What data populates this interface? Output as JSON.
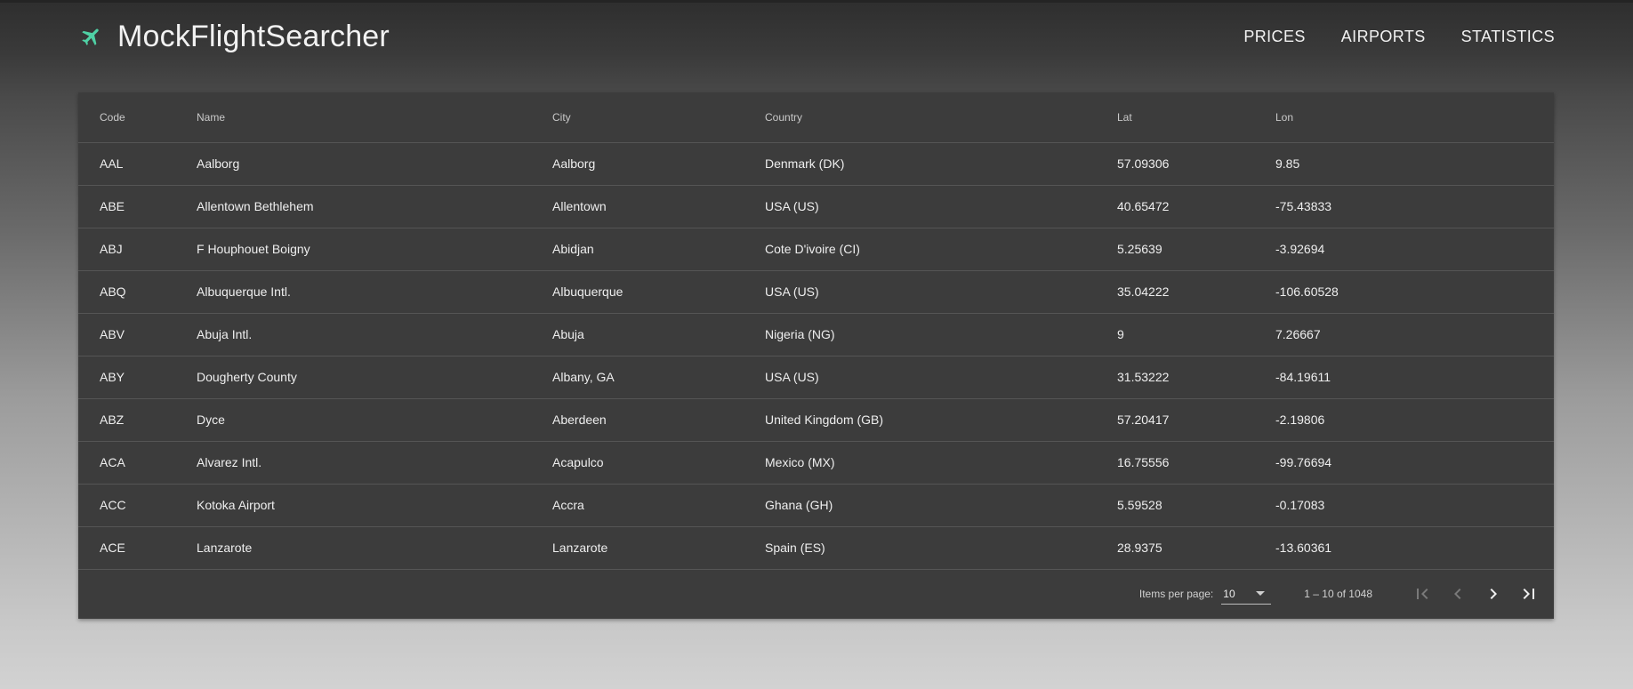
{
  "app": {
    "title": "MockFlightSearcher",
    "logo_icon": "airplane-icon",
    "accent": "#4fd1a5"
  },
  "nav": [
    "PRICES",
    "AIRPORTS",
    "STATISTICS"
  ],
  "table": {
    "columns": [
      "Code",
      "Name",
      "City",
      "Country",
      "Lat",
      "Lon"
    ],
    "rows": [
      [
        "AAL",
        "Aalborg",
        "Aalborg",
        "Denmark (DK)",
        "57.09306",
        "9.85"
      ],
      [
        "ABE",
        "Allentown Bethlehem",
        "Allentown",
        "USA (US)",
        "40.65472",
        "-75.43833"
      ],
      [
        "ABJ",
        "F Houphouet Boigny",
        "Abidjan",
        "Cote D'ivoire (CI)",
        "5.25639",
        "-3.92694"
      ],
      [
        "ABQ",
        "Albuquerque Intl.",
        "Albuquerque",
        "USA (US)",
        "35.04222",
        "-106.60528"
      ],
      [
        "ABV",
        "Abuja Intl.",
        "Abuja",
        "Nigeria (NG)",
        "9",
        "7.26667"
      ],
      [
        "ABY",
        "Dougherty County",
        "Albany, GA",
        "USA (US)",
        "31.53222",
        "-84.19611"
      ],
      [
        "ABZ",
        "Dyce",
        "Aberdeen",
        "United Kingdom (GB)",
        "57.20417",
        "-2.19806"
      ],
      [
        "ACA",
        "Alvarez Intl.",
        "Acapulco",
        "Mexico (MX)",
        "16.75556",
        "-99.76694"
      ],
      [
        "ACC",
        "Kotoka Airport",
        "Accra",
        "Ghana (GH)",
        "5.59528",
        "-0.17083"
      ],
      [
        "ACE",
        "Lanzarote",
        "Lanzarote",
        "Spain (ES)",
        "28.9375",
        "-13.60361"
      ]
    ]
  },
  "paginator": {
    "items_per_page_label": "Items per page:",
    "items_per_page_value": "10",
    "range_label": "1 – 10 of 1048"
  }
}
